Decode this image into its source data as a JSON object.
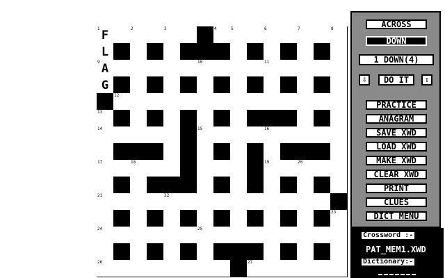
{
  "grid": {
    "rows": [
      "...#.........#.",
      "...#.........#.",
      "....#.........#",
      ".#.#.#.###.#.#.",
      "...#...#...#.#.",
      ".#.#.#.###.#.#.",
      "...#.#.#...#.#.",
      "...#.#.#.......",
      "...#.#.#...#.#.",
      ".#.#.#.###.#.#.",
      "...#...#...#.#.",
      ".#.#.#.###.#.#.",
      "....#.........#",
      ".#.#.........#.",
      ".#.#.........#."
    ],
    "blackCells": [
      [
        0,
        6
      ],
      [
        1,
        1
      ],
      [
        1,
        3
      ],
      [
        1,
        5
      ],
      [
        1,
        6
      ],
      [
        1,
        7
      ],
      [
        1,
        9
      ],
      [
        1,
        11
      ],
      [
        1,
        13
      ],
      [
        3,
        1
      ],
      [
        3,
        3
      ],
      [
        3,
        5
      ],
      [
        3,
        7
      ],
      [
        3,
        9
      ],
      [
        3,
        11
      ],
      [
        3,
        13
      ],
      [
        4,
        0
      ],
      [
        5,
        1
      ],
      [
        5,
        3
      ],
      [
        5,
        5
      ],
      [
        5,
        7
      ],
      [
        5,
        9
      ],
      [
        5,
        10
      ],
      [
        5,
        11
      ],
      [
        5,
        13
      ],
      [
        6,
        5
      ],
      [
        7,
        1
      ],
      [
        7,
        2
      ],
      [
        7,
        3
      ],
      [
        7,
        5
      ],
      [
        7,
        7
      ],
      [
        7,
        9
      ],
      [
        7,
        11
      ],
      [
        7,
        12
      ],
      [
        7,
        13
      ],
      [
        8,
        5
      ],
      [
        8,
        9
      ],
      [
        9,
        1
      ],
      [
        9,
        3
      ],
      [
        9,
        4
      ],
      [
        9,
        5
      ],
      [
        9,
        7
      ],
      [
        9,
        9
      ],
      [
        9,
        11
      ],
      [
        9,
        13
      ],
      [
        10,
        14
      ],
      [
        11,
        1
      ],
      [
        11,
        3
      ],
      [
        11,
        5
      ],
      [
        11,
        7
      ],
      [
        11,
        9
      ],
      [
        11,
        11
      ],
      [
        11,
        13
      ],
      [
        13,
        1
      ],
      [
        13,
        3
      ],
      [
        13,
        5
      ],
      [
        13,
        7
      ],
      [
        13,
        8
      ],
      [
        13,
        9
      ],
      [
        13,
        11
      ],
      [
        13,
        13
      ],
      [
        14,
        8
      ]
    ],
    "numbers": [
      {
        "r": 0,
        "c": 0,
        "n": "1"
      },
      {
        "r": 0,
        "c": 2,
        "n": "2"
      },
      {
        "r": 0,
        "c": 4,
        "n": "3"
      },
      {
        "r": 0,
        "c": 7,
        "n": "4"
      },
      {
        "r": 0,
        "c": 8,
        "n": "5"
      },
      {
        "r": 0,
        "c": 10,
        "n": "6"
      },
      {
        "r": 0,
        "c": 12,
        "n": "7"
      },
      {
        "r": 0,
        "c": 14,
        "n": "8"
      },
      {
        "r": 2,
        "c": 0,
        "n": "9"
      },
      {
        "r": 2,
        "c": 6,
        "n": "10"
      },
      {
        "r": 2,
        "c": 10,
        "n": "11"
      },
      {
        "r": 4,
        "c": 1,
        "n": "12"
      },
      {
        "r": 5,
        "c": 0,
        "n": "13"
      },
      {
        "r": 6,
        "c": 0,
        "n": "14"
      },
      {
        "r": 6,
        "c": 6,
        "n": "15"
      },
      {
        "r": 6,
        "c": 10,
        "n": "16"
      },
      {
        "r": 8,
        "c": 0,
        "n": "17"
      },
      {
        "r": 8,
        "c": 2,
        "n": "18"
      },
      {
        "r": 8,
        "c": 10,
        "n": "19"
      },
      {
        "r": 8,
        "c": 12,
        "n": "20"
      },
      {
        "r": 10,
        "c": 0,
        "n": "21"
      },
      {
        "r": 10,
        "c": 4,
        "n": "22"
      },
      {
        "r": 11,
        "c": 14,
        "n": "23"
      },
      {
        "r": 12,
        "c": 0,
        "n": "24"
      },
      {
        "r": 12,
        "c": 6,
        "n": "25"
      },
      {
        "r": 14,
        "c": 0,
        "n": "26"
      },
      {
        "r": 14,
        "c": 9,
        "n": "27"
      }
    ],
    "letters": [
      {
        "r": 0,
        "c": 0,
        "ch": "F"
      },
      {
        "r": 1,
        "c": 0,
        "ch": "L"
      },
      {
        "r": 2,
        "c": 0,
        "ch": "A"
      },
      {
        "r": 3,
        "c": 0,
        "ch": "G"
      }
    ]
  },
  "panel": {
    "across_label": "ACROSS",
    "down_label": "DOWN",
    "current_clue": "1 DOWN(4)",
    "down_arrow": "⇩",
    "do_it_label": "DO IT",
    "up_arrow": "⇧",
    "menu": [
      "PRACTICE",
      "ANAGRAM",
      "SAVE XWD",
      "LOAD XWD",
      "MAKE XWD",
      "CLEAR XWD",
      "PRINT",
      "CLUES",
      "DICT MENU"
    ]
  },
  "status": {
    "crossword_label": "Crossword :-",
    "crossword_value": "PAT_MEM1.XWD",
    "dictionary_label": "Dictionary:-"
  }
}
